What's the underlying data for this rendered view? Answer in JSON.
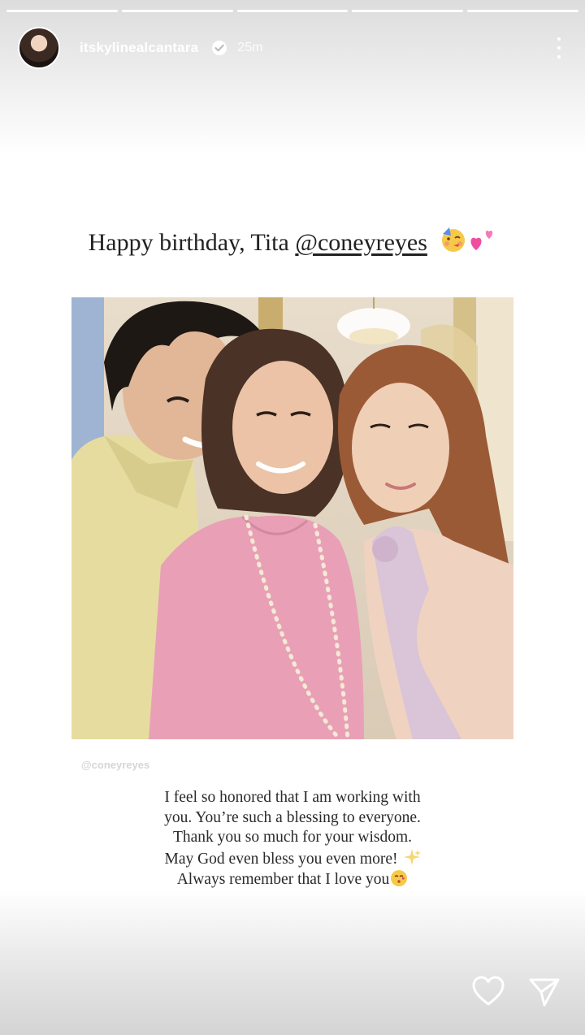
{
  "story": {
    "progress_segments": [
      1,
      1,
      1,
      1,
      1
    ],
    "username": "itskylinealcantara",
    "timestamp": "25m",
    "icons": {
      "verified": "verified-badge-icon",
      "more": "more-options-icon",
      "like": "heart-icon",
      "share": "send-icon"
    }
  },
  "post": {
    "headline_prefix": "Happy birthday, Tita ",
    "headline_mention": "@coneyreyes",
    "headline_emojis": [
      "partying-face-emoji",
      "two-hearts-emoji"
    ],
    "photo_credit": "@coneyreyes",
    "caption_lines": [
      "I feel so honored that I am working with",
      "you. You’re such a blessing to everyone.",
      "Thank you so much for your wisdom.",
      "May God even bless you even more!",
      "Always remember that I love you"
    ],
    "caption_emojis": [
      "sparkles-emoji",
      "kissing-face-emoji"
    ]
  },
  "colors": {
    "accent_pink": "#e9a0b6",
    "text": "#222222"
  }
}
